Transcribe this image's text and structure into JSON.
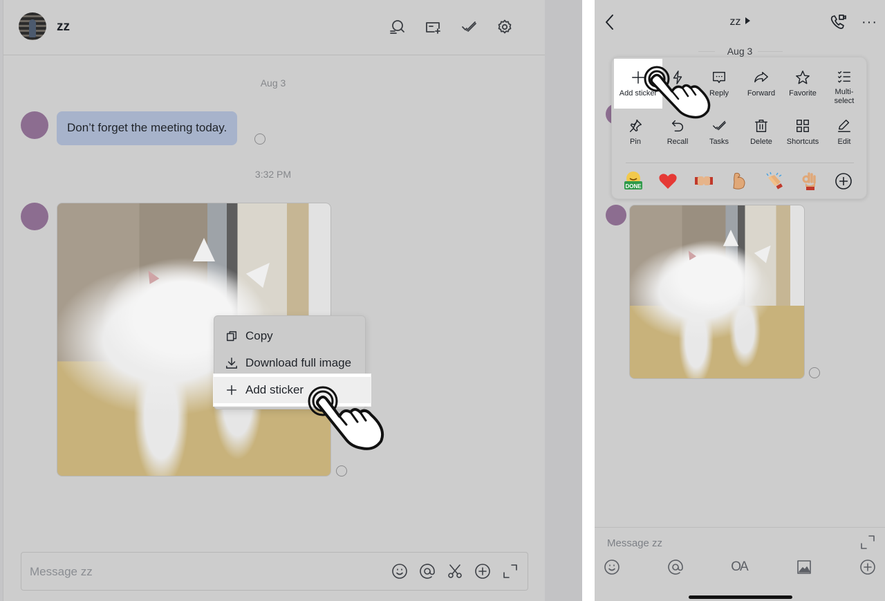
{
  "desktop": {
    "header": {
      "chat_title": "zz",
      "icons": [
        "search-history-icon",
        "add-task-card-icon",
        "tasks-check-icon",
        "settings-gear-icon"
      ]
    },
    "messages": {
      "date_separator": "Aug 3",
      "text_message": "Don’t forget the meeting today.",
      "time_separator": "3:32 PM",
      "image_message_alt": "White kitten sleeping on cat tree"
    },
    "context_menu": {
      "items": [
        {
          "icon": "copy-icon",
          "label": "Copy"
        },
        {
          "icon": "download-icon",
          "label": "Download full image"
        },
        {
          "icon": "plus-icon",
          "label": "Add sticker",
          "highlighted": true
        }
      ]
    },
    "composer": {
      "placeholder": "Message zz",
      "value": "",
      "icons": [
        "emoji-icon",
        "mention-icon",
        "screenshot-scissors-icon",
        "add-icon",
        "expand-icon"
      ]
    }
  },
  "mobile": {
    "header": {
      "title": "zz",
      "icons": [
        "back-icon",
        "video-call-icon",
        "more-icon"
      ]
    },
    "date_separator": "Aug 3",
    "action_panel": {
      "row1": [
        {
          "icon": "plus-icon",
          "label": "Add sticker",
          "highlighted": true
        },
        {
          "icon": "lightning-icon",
          "label": ""
        },
        {
          "icon": "reply-icon",
          "label": "Reply"
        },
        {
          "icon": "forward-icon",
          "label": "Forward"
        },
        {
          "icon": "star-icon",
          "label": "Favorite"
        },
        {
          "icon": "multiselect-icon",
          "label": "Multi-\nselect"
        }
      ],
      "row2": [
        {
          "icon": "pin-icon",
          "label": "Pin"
        },
        {
          "icon": "recall-icon",
          "label": "Recall"
        },
        {
          "icon": "tasks-icon",
          "label": "Tasks"
        },
        {
          "icon": "trash-icon",
          "label": "Delete"
        },
        {
          "icon": "grid-icon",
          "label": "Shortcuts"
        },
        {
          "icon": "edit-pencil-icon",
          "label": "Edit"
        }
      ],
      "reactions": [
        "✅",
        "❤️",
        "🤜🤛",
        "💪",
        "👏",
        "👌"
      ],
      "reaction_names": [
        "done-reaction",
        "heart-reaction",
        "fist-bump-reaction",
        "muscle-reaction",
        "clap-reaction",
        "ok-hand-reaction"
      ]
    },
    "composer": {
      "placeholder": "Message zz",
      "value": "",
      "format_label": "OA",
      "icons": [
        "emoji-icon",
        "mention-icon",
        "format-text-icon",
        "image-icon",
        "add-icon",
        "expand-icon"
      ]
    }
  },
  "colors": {
    "bubble": "#a7b3cb",
    "avatar": "#8c6d90",
    "background": "#cdcdcd",
    "highlight": "#ffffff"
  }
}
